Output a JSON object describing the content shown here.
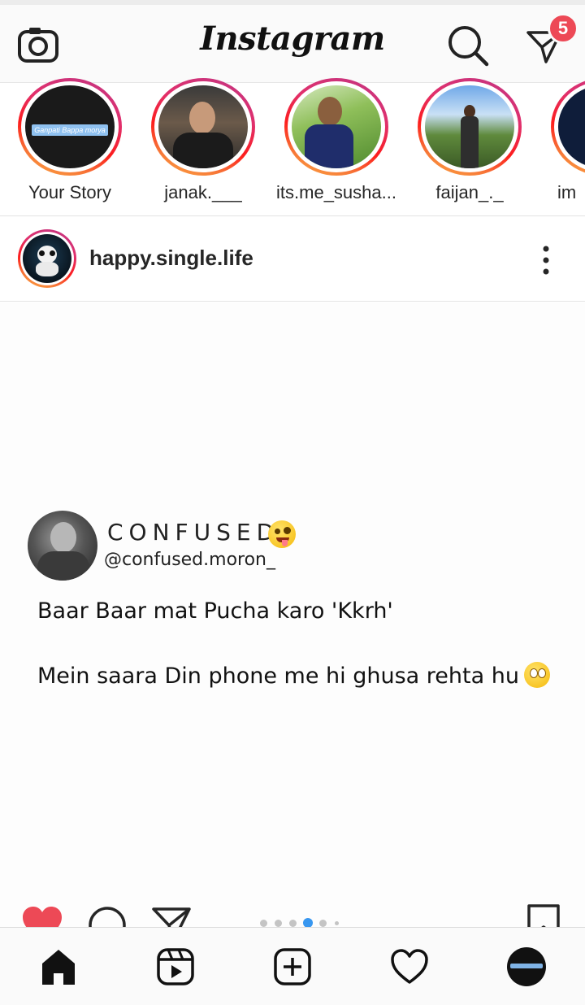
{
  "app": {
    "title": "Instagram",
    "dm_badge": "5",
    "accent": "#ed4956"
  },
  "stories": [
    {
      "name": "Your Story",
      "thumb_text": "Ganpati Bappa morya"
    },
    {
      "name": "janak.___"
    },
    {
      "name": "its.me_susha..."
    },
    {
      "name": "faijan_._"
    },
    {
      "name": "im"
    }
  ],
  "post": {
    "username": "happy.single.life",
    "quote": {
      "title": "CONFUSED",
      "handle": "@confused.moron_",
      "line1": "Baar Baar mat Pucha karo 'Kkrh'",
      "line2": "Mein saara Din phone me hi ghusa rehta hu"
    },
    "carousel": {
      "count": 6,
      "active_index": 3
    },
    "liked": true
  },
  "nav": {
    "items": [
      "home-icon",
      "reels-icon",
      "new-post-icon",
      "activity-heart-icon",
      "profile-avatar"
    ]
  }
}
